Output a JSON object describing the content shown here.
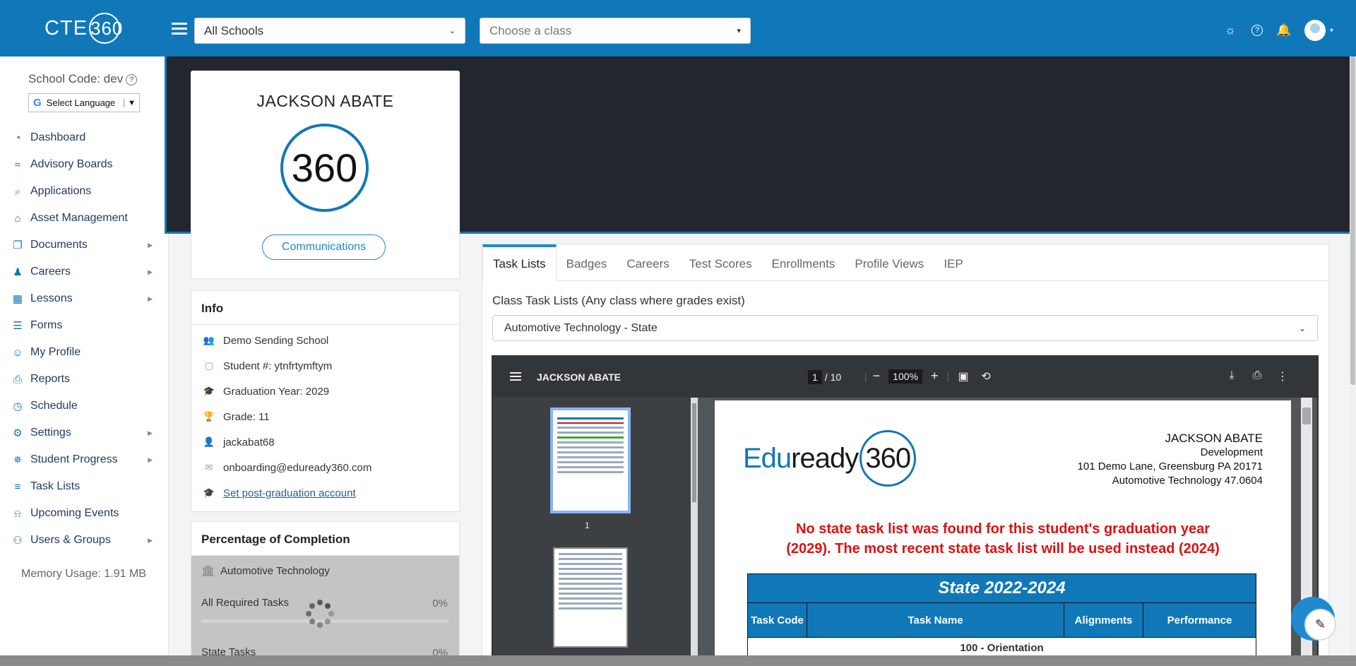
{
  "header": {
    "logo_text": "CTE",
    "logo_ring": "360",
    "school_select": "All Schools",
    "class_select_placeholder": "Choose a class",
    "icons": [
      "lightbulb-icon",
      "help-icon",
      "bell-icon",
      "user-avatar"
    ]
  },
  "sidebar": {
    "school_code": "School Code: dev",
    "language": "Select Language",
    "items": [
      {
        "label": "Dashboard",
        "icon": "dashboard-icon",
        "arrow": false
      },
      {
        "label": "Advisory Boards",
        "icon": "handshake-icon",
        "arrow": false
      },
      {
        "label": "Applications",
        "icon": "search-doc-icon",
        "arrow": false
      },
      {
        "label": "Asset Management",
        "icon": "warehouse-icon",
        "arrow": false
      },
      {
        "label": "Documents",
        "icon": "document-icon",
        "arrow": true
      },
      {
        "label": "Careers",
        "icon": "people-icon",
        "arrow": true
      },
      {
        "label": "Lessons",
        "icon": "board-icon",
        "arrow": true
      },
      {
        "label": "Forms",
        "icon": "form-icon",
        "arrow": false
      },
      {
        "label": "My Profile",
        "icon": "user-icon",
        "arrow": false
      },
      {
        "label": "Reports",
        "icon": "printer-icon",
        "arrow": false
      },
      {
        "label": "Schedule",
        "icon": "clock-icon",
        "arrow": false
      },
      {
        "label": "Settings",
        "icon": "gears-icon",
        "arrow": true
      },
      {
        "label": "Student Progress",
        "icon": "spinner-icon",
        "arrow": true
      },
      {
        "label": "Task Lists",
        "icon": "list-icon",
        "arrow": false
      },
      {
        "label": "Upcoming Events",
        "icon": "bell-icon",
        "arrow": false
      },
      {
        "label": "Users & Groups",
        "icon": "users-icon",
        "arrow": true
      }
    ],
    "memory": "Memory Usage: 1.91 MB"
  },
  "profile": {
    "name": "JACKSON ABATE",
    "logo_text": "360",
    "communications": "Communications"
  },
  "info": {
    "title": "Info",
    "school": "Demo Sending School",
    "student_num": "Student #: ytnfrtymftym",
    "grad_year": "Graduation Year: 2029",
    "grade": "Grade: 11",
    "username": "jackabat68",
    "email": "onboarding@eduready360.com",
    "post_grad_link": "Set post-graduation account"
  },
  "completion": {
    "title": "Percentage of Completion",
    "program": "Automotive Technology",
    "rows": [
      {
        "label": "All Required Tasks",
        "value": "0%",
        "fraction": 0
      },
      {
        "label": "State Tasks",
        "value": "0%",
        "fraction": 0
      }
    ]
  },
  "tabs": [
    "Task Lists",
    "Badges",
    "Careers",
    "Test Scores",
    "Enrollments",
    "Profile Views",
    "IEP"
  ],
  "task_lists": {
    "label": "Class Task Lists (Any class where grades exist)",
    "selected": "Automotive Technology - State"
  },
  "pdf": {
    "title": "JACKSON ABATE",
    "page": "1",
    "pages": "/ 10",
    "zoom": "100%",
    "thumb_label": "1",
    "doc": {
      "brand_prefix": "Edu",
      "brand_mid": "ready",
      "brand_ring": "360",
      "student": "JACKSON ABATE",
      "line2": "Development",
      "line3": "101 Demo Lane, Greensburg PA 20171",
      "line4": "Automotive Technology 47.0604",
      "warning1": "No state task list was found for this student's graduation year",
      "warning2": "(2029). The most recent state task list will be used instead (2024)",
      "table_title": "State 2022-2024",
      "col_code": "Task Code",
      "col_name": "Task Name",
      "col_align": "Alignments",
      "col_perf": "Performance",
      "section": "100 - Orientation"
    }
  },
  "colors": {
    "primary": "#1078b8",
    "banner": "#23252f",
    "warning": "#e01010"
  }
}
